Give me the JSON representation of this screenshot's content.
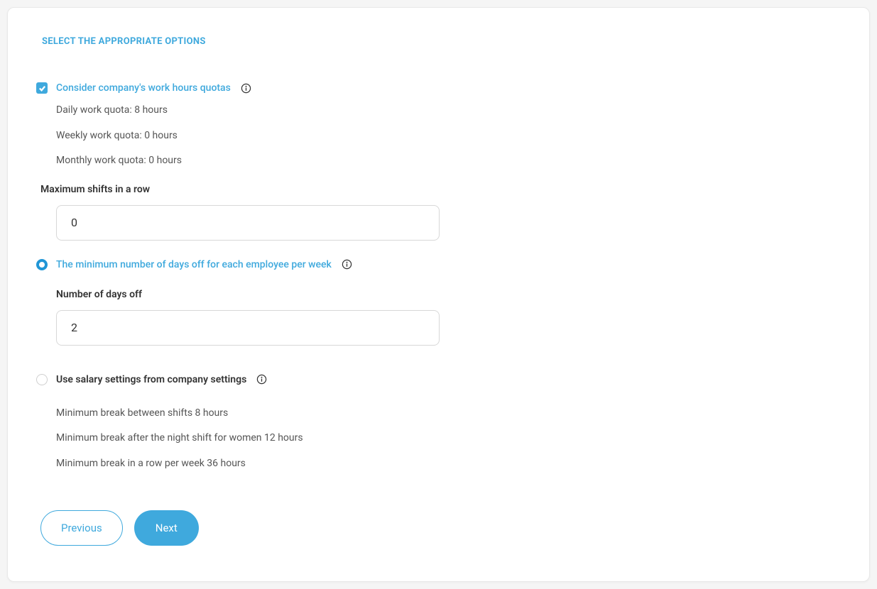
{
  "section_title": "SELECT THE APPROPRIATE OPTIONS",
  "options": {
    "quotas": {
      "label": "Consider company's work hours quotas",
      "daily": "Daily work quota: 8 hours",
      "weekly": "Weekly work quota: 0 hours",
      "monthly": "Monthly work quota: 0 hours"
    },
    "max_shifts": {
      "label": "Maximum shifts in a row",
      "value": "0"
    },
    "days_off": {
      "label": "The minimum number of days off for each employee per week",
      "sub_label": "Number of days off",
      "value": "2"
    },
    "salary": {
      "label": "Use salary settings from company settings",
      "break_between": "Minimum break between shifts 8 hours",
      "break_night_women": "Minimum break after the night shift for women 12 hours",
      "break_row_week": "Minimum break in a row per week 36 hours"
    }
  },
  "buttons": {
    "previous": "Previous",
    "next": "Next"
  }
}
